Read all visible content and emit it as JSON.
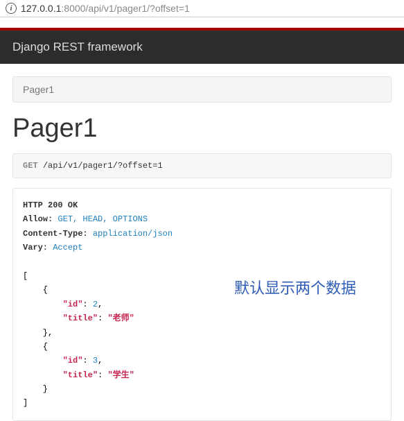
{
  "address": {
    "host": "127.0.0.1",
    "path": ":8000/api/v1/pager1/?offset=1"
  },
  "header": {
    "title": "Django REST framework"
  },
  "breadcrumb": {
    "label": "Pager1"
  },
  "page": {
    "title": "Pager1"
  },
  "request": {
    "method": "GET",
    "path": "/api/v1/pager1/?offset=1"
  },
  "response": {
    "status_line": "HTTP 200 OK",
    "headers": {
      "allow_key": "Allow:",
      "allow_val": "GET, HEAD, OPTIONS",
      "ctype_key": "Content-Type:",
      "ctype_val": "application/json",
      "vary_key": "Vary:",
      "vary_val": "Accept"
    },
    "body": {
      "items": [
        {
          "id_key": "\"id\"",
          "id_val": "2",
          "title_key": "\"title\"",
          "title_val": "\"老师\""
        },
        {
          "id_key": "\"id\"",
          "id_val": "3",
          "title_key": "\"title\"",
          "title_val": "\"学生\""
        }
      ]
    }
  },
  "annotation": {
    "text": "默认显示两个数据"
  }
}
